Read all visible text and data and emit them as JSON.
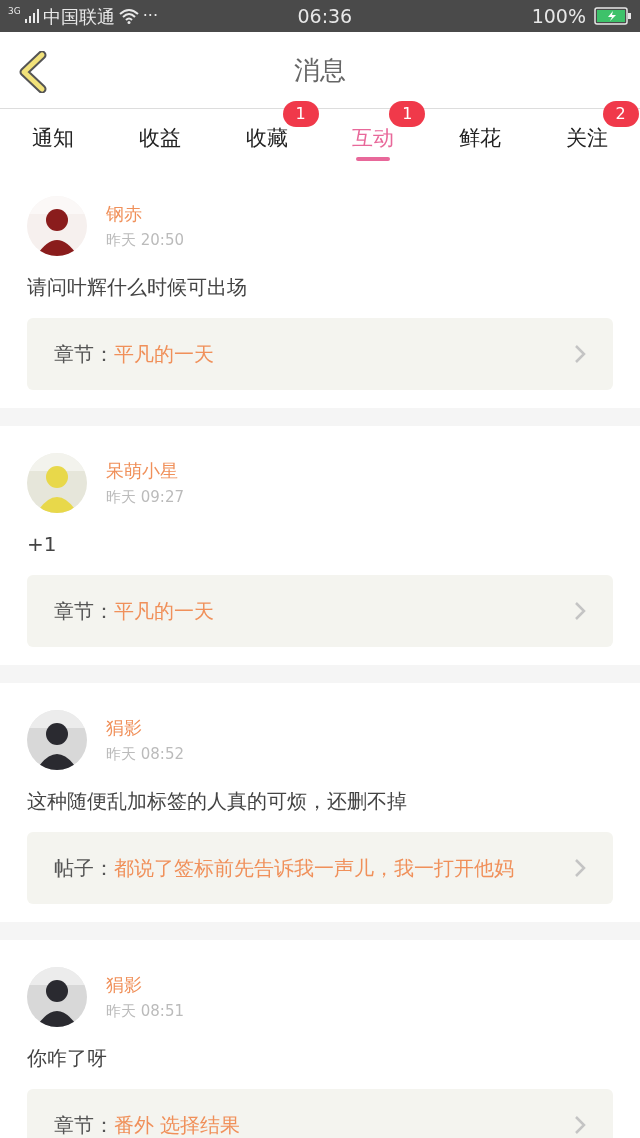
{
  "status_bar": {
    "network": "3G",
    "carrier": "中国联通",
    "more": "···",
    "time": "06:36",
    "battery": "100%"
  },
  "header": {
    "title": "消息"
  },
  "tabs": [
    {
      "label": "通知",
      "selected": false
    },
    {
      "label": "收益",
      "selected": false
    },
    {
      "label": "收藏",
      "selected": false,
      "badge": "1"
    },
    {
      "label": "互动",
      "selected": true,
      "badge": "1"
    },
    {
      "label": "鲜花",
      "selected": false
    },
    {
      "label": "关注",
      "selected": false,
      "badge": "2"
    }
  ],
  "messages": [
    {
      "user": "钢赤",
      "time": "昨天 20:50",
      "text": "请问叶辉什么时候可出场",
      "link": {
        "label": "章节：",
        "title": "平凡的一天"
      }
    },
    {
      "user": "呆萌小星",
      "time": "昨天 09:27",
      "text": "+1",
      "link": {
        "label": "章节：",
        "title": "平凡的一天"
      }
    },
    {
      "user": "狷影",
      "time": "昨天 08:52",
      "text": "这种随便乱加标签的人真的可烦，还删不掉",
      "link": {
        "label": "帖子：",
        "title": "都说了签标前先告诉我一声儿，我一打开他妈"
      }
    },
    {
      "user": "狷影",
      "time": "昨天 08:51",
      "text": "你咋了呀",
      "link": {
        "label": "章节：",
        "title": "番外 选择结果"
      }
    }
  ]
}
